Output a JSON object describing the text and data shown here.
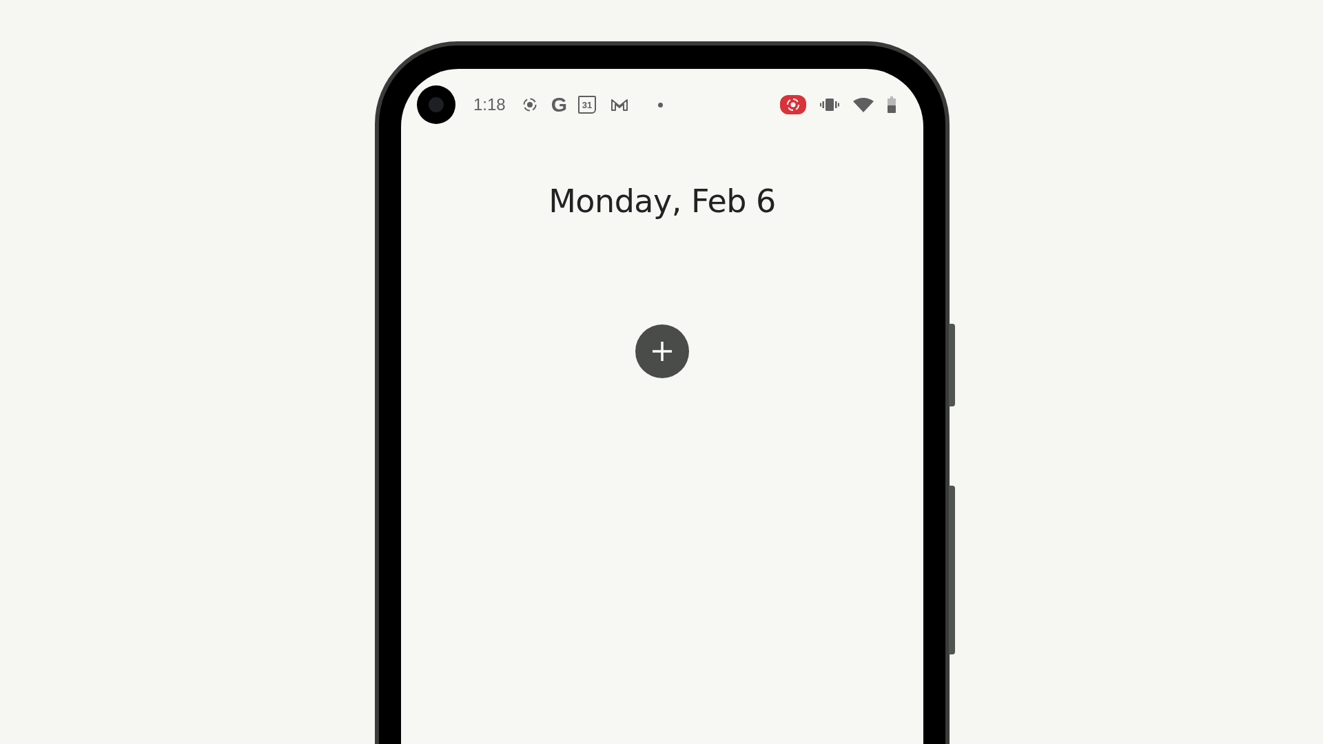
{
  "status_bar": {
    "time": "1:18",
    "google_letter": "G",
    "calendar_day": "31",
    "recording": true
  },
  "date_title": "Monday, Feb 6"
}
